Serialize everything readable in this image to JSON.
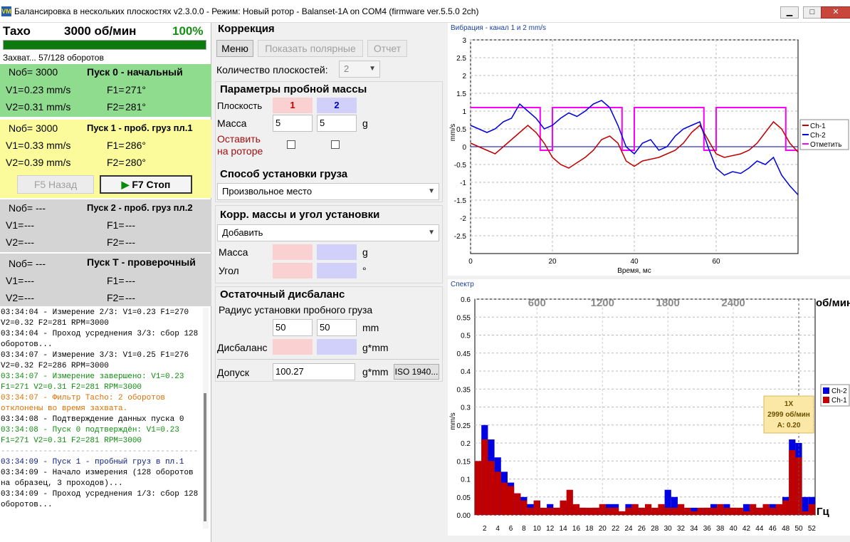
{
  "window": {
    "title": "Балансировка в нескольких плоскостях v2.3.0.0 - Режим: Новый ротор - Balanset-1A on COM4 (firmware ver.5.5.0 2ch)",
    "icon_text": "VM"
  },
  "tacho": {
    "label": "Тахо",
    "rpm": "3000 об/мин",
    "percent": "100%",
    "progress": 1.0,
    "capture_status": "Захват... 57/128 оборотов"
  },
  "runs": [
    {
      "nob_label": "Nоб=",
      "nob": "3000",
      "title": "Пуск 0 - начальный",
      "v1_label": "V1=",
      "v1": "0.23 mm/s",
      "f1_label": "F1=",
      "f1": "271°",
      "v2_label": "V2=",
      "v2": "0.31 mm/s",
      "f2_label": "F2=",
      "f2": "281°",
      "color": "#8fdc8f"
    },
    {
      "nob_label": "Nоб=",
      "nob": "3000",
      "title": "Пуск 1 - проб. груз пл.1",
      "v1_label": "V1=",
      "v1": "0.33 mm/s",
      "f1_label": "F1=",
      "f1": "286°",
      "v2_label": "V2=",
      "v2": "0.39 mm/s",
      "f2_label": "F2=",
      "f2": "280°",
      "color": "#fbfb9c"
    },
    {
      "nob_label": "Nоб=",
      "nob": "---",
      "title": "Пуск 2 - проб. груз пл.2",
      "v1_label": "V1=",
      "v1": "---",
      "f1_label": "F1=",
      "f1": "---",
      "v2_label": "V2=",
      "v2": "---",
      "f2_label": "F2=",
      "f2": "---",
      "color": "#d4d4d4"
    },
    {
      "nob_label": "Nоб=",
      "nob": "---",
      "title": "Пуск T - проверочный",
      "v1_label": "V1=",
      "v1": "---",
      "f1_label": "F1=",
      "f1": "---",
      "v2_label": "V2=",
      "v2": "---",
      "f2_label": "F2=",
      "f2": "---",
      "color": "#d4d4d4"
    }
  ],
  "run_buttons": {
    "back": "F5 Назад",
    "stop": "F7 Стоп",
    "stop_icon": "play-triangle-icon"
  },
  "log": [
    {
      "text": "03:34:04 - Измерение 2/3: V1=0.23 F1=270 V2=0.32 F2=281 RPM=3000",
      "kind": "black"
    },
    {
      "text": "03:34:04 - Проход усреднения 3/3: сбор 128 оборотов...",
      "kind": "black"
    },
    {
      "text": "03:34:07 - Измерение 3/3: V1=0.25 F1=276 V2=0.32 F2=286 RPM=3000",
      "kind": "black"
    },
    {
      "text": "03:34:07 - Измерение завершено: V1=0.23 F1=271 V2=0.31 F2=281 RPM=3000",
      "kind": "green"
    },
    {
      "text": "03:34:07 - Фильтр Tacho: 2 оборотов отклонены во время захвата.",
      "kind": "orange"
    },
    {
      "text": "03:34:08 - Подтверждение данных пуска 0",
      "kind": "black"
    },
    {
      "text": "03:34:08 - Пуск 0 подтверждён: V1=0.23 F1=271 V2=0.31 F2=281 RPM=3000",
      "kind": "green"
    },
    {
      "text": "------------------------------------------",
      "kind": "sep"
    },
    {
      "text": "03:34:09 - Пуск 1 - пробный груз в пл.1",
      "kind": "blue"
    },
    {
      "text": "03:34:09 - Начало измерения (128 оборотов на образец, 3 проходов)...",
      "kind": "black"
    },
    {
      "text": "03:34:09 - Проход усреднения 1/3: сбор 128 оборотов...",
      "kind": "black"
    }
  ],
  "correction": {
    "title": "Коррекция",
    "menu_btn": "Меню",
    "polar_btn": "Показать полярные",
    "report_btn": "Отчет",
    "planes_label": "Количество плоскостей:",
    "planes_value": "2"
  },
  "trial_mass": {
    "title": "Параметры пробной массы",
    "plane_label": "Плоскость",
    "plane1": "1",
    "plane2": "2",
    "mass_label": "Масса",
    "mass1": "5",
    "mass2": "5",
    "mass_unit": "g",
    "leave_label_1": "Оставить",
    "leave_label_2": "на роторе"
  },
  "install_method": {
    "title": "Способ установки груза",
    "value": "Произвольное место"
  },
  "corr_mass": {
    "title": "Корр. массы и угол установки",
    "value": "Добавить",
    "mass_label": "Масса",
    "mass_unit": "g",
    "angle_label": "Угол",
    "angle_unit": "°"
  },
  "residual": {
    "title": "Остаточный дисбаланс",
    "radius_label": "Радиус установки пробного груза",
    "radius1": "50",
    "radius2": "50",
    "radius_unit": "mm",
    "imbalance_label": "Дисбаланс",
    "imbalance_unit": "g*mm",
    "tolerance_label": "Допуск",
    "tolerance_value": "100.27",
    "tolerance_unit": "g*mm",
    "iso_btn": "ISO 1940..."
  },
  "colors": {
    "ch1": "#c00000",
    "ch2": "#0000e0",
    "mark": "#ff00ff",
    "zero": "#0000a0"
  },
  "vibration_chart": {
    "title": "Вибрация - канал 1 и 2 mm/s",
    "ylabel": "mm/s",
    "xlabel": "Время, мс",
    "y_ticks": [
      "3",
      "2.5",
      "2",
      "1.5",
      "1",
      "0.5",
      "0",
      "-0.5",
      "-1",
      "-1.5",
      "-2",
      "-2.5"
    ],
    "x_ticks": [
      "0",
      "20",
      "40",
      "60"
    ],
    "legend": [
      "Ch-1",
      "Ch-2",
      "Отметить"
    ]
  },
  "spectrum_chart": {
    "title": "Спектр",
    "ylabel": "mm/s",
    "rpm_unit_label": "об/мин",
    "hz_label": "Гц",
    "y_ticks": [
      "0.6",
      "0.55",
      "0.5",
      "0.45",
      "0.4",
      "0.35",
      "0.3",
      "0.25",
      "0.2",
      "0.15",
      "0.1",
      "0.05",
      "0.00"
    ],
    "x_ticks": [
      "2",
      "4",
      "6",
      "8",
      "10",
      "12",
      "14",
      "16",
      "18",
      "20",
      "22",
      "24",
      "26",
      "28",
      "30",
      "32",
      "34",
      "36",
      "38",
      "40",
      "42",
      "44",
      "46",
      "48",
      "50",
      "52"
    ],
    "rpm_ticks": [
      "600",
      "1200",
      "1800",
      "2400"
    ],
    "legend": [
      "Ch-2",
      "Ch-1"
    ],
    "tooltip": {
      "line1": "1X",
      "line2": "2999 об/мин",
      "line3": "A: 0.20"
    }
  },
  "chart_data": [
    {
      "type": "line",
      "title": "Вибрация - канал 1 и 2 mm/s",
      "xlabel": "Время, мс",
      "ylabel": "mm/s",
      "xlim": [
        0,
        80
      ],
      "ylim": [
        -3.0,
        3.0
      ],
      "series": [
        {
          "name": "Ch-1",
          "x": [
            0,
            2,
            4,
            6,
            8,
            10,
            12,
            14,
            16,
            18,
            20,
            22,
            24,
            26,
            28,
            30,
            32,
            34,
            36,
            38,
            40,
            42,
            44,
            46,
            48,
            50,
            52,
            54,
            56,
            58,
            60,
            62,
            64,
            66,
            68,
            70,
            72,
            74,
            76,
            78,
            80
          ],
          "values": [
            0.1,
            0.0,
            -0.1,
            -0.2,
            0.0,
            0.2,
            0.4,
            0.6,
            0.4,
            0.1,
            -0.3,
            -0.5,
            -0.6,
            -0.45,
            -0.3,
            -0.1,
            0.2,
            0.3,
            0.1,
            -0.4,
            -0.55,
            -0.4,
            -0.35,
            -0.3,
            -0.2,
            -0.1,
            0.1,
            0.4,
            0.6,
            0.2,
            -0.2,
            -0.3,
            -0.25,
            -0.2,
            -0.1,
            0.1,
            0.4,
            0.7,
            0.5,
            0.1,
            -0.15
          ]
        },
        {
          "name": "Ch-2",
          "x": [
            0,
            2,
            4,
            6,
            8,
            10,
            12,
            14,
            16,
            18,
            20,
            22,
            24,
            26,
            28,
            30,
            32,
            34,
            36,
            38,
            40,
            42,
            44,
            46,
            48,
            50,
            52,
            54,
            56,
            58,
            60,
            62,
            64,
            66,
            68,
            70,
            72,
            74,
            76,
            78,
            80
          ],
          "values": [
            0.6,
            0.5,
            0.4,
            0.5,
            0.7,
            0.8,
            1.2,
            1.0,
            0.8,
            0.5,
            0.6,
            0.8,
            0.95,
            0.85,
            1.0,
            1.2,
            1.3,
            1.1,
            0.6,
            0.0,
            -0.2,
            0.1,
            0.2,
            -0.1,
            0.0,
            0.3,
            0.5,
            0.6,
            0.7,
            0.0,
            -0.6,
            -0.8,
            -0.7,
            -0.75,
            -0.6,
            -0.4,
            -0.5,
            -0.3,
            -0.8,
            -1.1,
            -1.35
          ]
        },
        {
          "name": "Отметить",
          "x": [
            0,
            17,
            17,
            20,
            20,
            37,
            37,
            40,
            40,
            57,
            57,
            60,
            60,
            77,
            77,
            80
          ],
          "values": [
            1.1,
            1.1,
            -0.1,
            -0.1,
            1.1,
            1.1,
            -0.1,
            -0.1,
            1.1,
            1.1,
            -0.1,
            -0.1,
            1.1,
            1.1,
            -0.1,
            -0.1
          ]
        }
      ]
    },
    {
      "type": "bar",
      "title": "Спектр",
      "ylabel": "mm/s",
      "xlabel": "Гц",
      "ylim": [
        0,
        0.6
      ],
      "categories": [
        1,
        2,
        3,
        4,
        5,
        6,
        7,
        8,
        9,
        10,
        11,
        12,
        13,
        14,
        15,
        16,
        17,
        18,
        19,
        20,
        21,
        22,
        23,
        24,
        25,
        26,
        27,
        28,
        29,
        30,
        31,
        32,
        33,
        34,
        35,
        36,
        37,
        38,
        39,
        40,
        41,
        42,
        43,
        44,
        45,
        46,
        47,
        48,
        49,
        50,
        51,
        52
      ],
      "series": [
        {
          "name": "Ch-2",
          "values": [
            0.07,
            0.25,
            0.21,
            0.16,
            0.12,
            0.09,
            0.06,
            0.05,
            0.03,
            0.04,
            0.01,
            0.03,
            0.02,
            0.04,
            0.03,
            0.02,
            0.02,
            0.01,
            0.02,
            0.02,
            0.03,
            0.03,
            0.01,
            0.03,
            0.02,
            0.02,
            0.02,
            0.01,
            0.02,
            0.07,
            0.05,
            0.02,
            0.01,
            0.02,
            0.01,
            0.02,
            0.03,
            0.02,
            0.03,
            0.02,
            0.01,
            0.03,
            0.02,
            0.02,
            0.02,
            0.03,
            0.02,
            0.05,
            0.21,
            0.2,
            0.05,
            0.05
          ]
        },
        {
          "name": "Ch-1",
          "values": [
            0.15,
            0.21,
            0.15,
            0.12,
            0.09,
            0.08,
            0.06,
            0.04,
            0.02,
            0.04,
            0.02,
            0.02,
            0.02,
            0.04,
            0.07,
            0.03,
            0.02,
            0.02,
            0.02,
            0.03,
            0.02,
            0.02,
            0.01,
            0.02,
            0.03,
            0.02,
            0.03,
            0.02,
            0.03,
            0.02,
            0.02,
            0.03,
            0.02,
            0.01,
            0.02,
            0.02,
            0.02,
            0.03,
            0.02,
            0.02,
            0.02,
            0.01,
            0.03,
            0.02,
            0.03,
            0.02,
            0.03,
            0.04,
            0.18,
            0.16,
            0.01,
            0.03
          ]
        }
      ]
    }
  ]
}
